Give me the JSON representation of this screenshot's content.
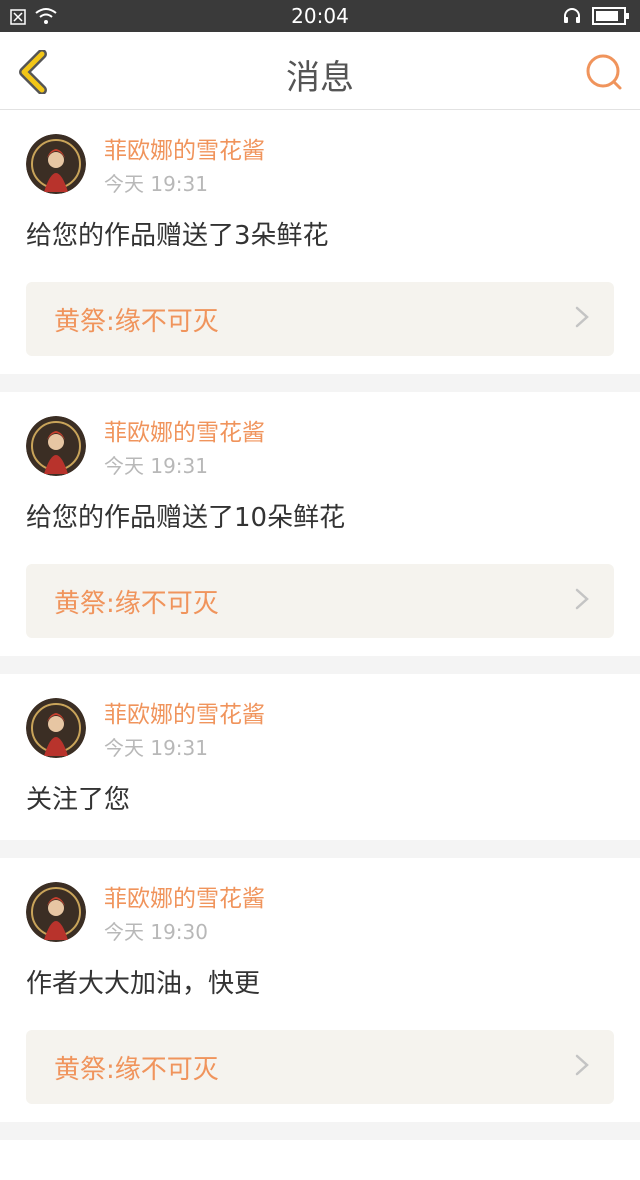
{
  "status": {
    "time": "20:04"
  },
  "nav": {
    "title": "消息"
  },
  "messages": [
    {
      "user": "菲欧娜的雪花酱",
      "time": "今天 19:31",
      "text": "给您的作品赠送了3朵鲜花",
      "work": "黄祭:缘不可灭"
    },
    {
      "user": "菲欧娜的雪花酱",
      "time": "今天 19:31",
      "text": "给您的作品赠送了10朵鲜花",
      "work": "黄祭:缘不可灭"
    },
    {
      "user": "菲欧娜的雪花酱",
      "time": "今天 19:31",
      "text": "关注了您"
    },
    {
      "user": "菲欧娜的雪花酱",
      "time": "今天 19:30",
      "text": "作者大大加油，快更",
      "work": "黄祭:缘不可灭"
    }
  ],
  "colors": {
    "accent": "#f0945c",
    "back_arrow": "#f2c617",
    "statusbar": "#3a3a3a"
  }
}
